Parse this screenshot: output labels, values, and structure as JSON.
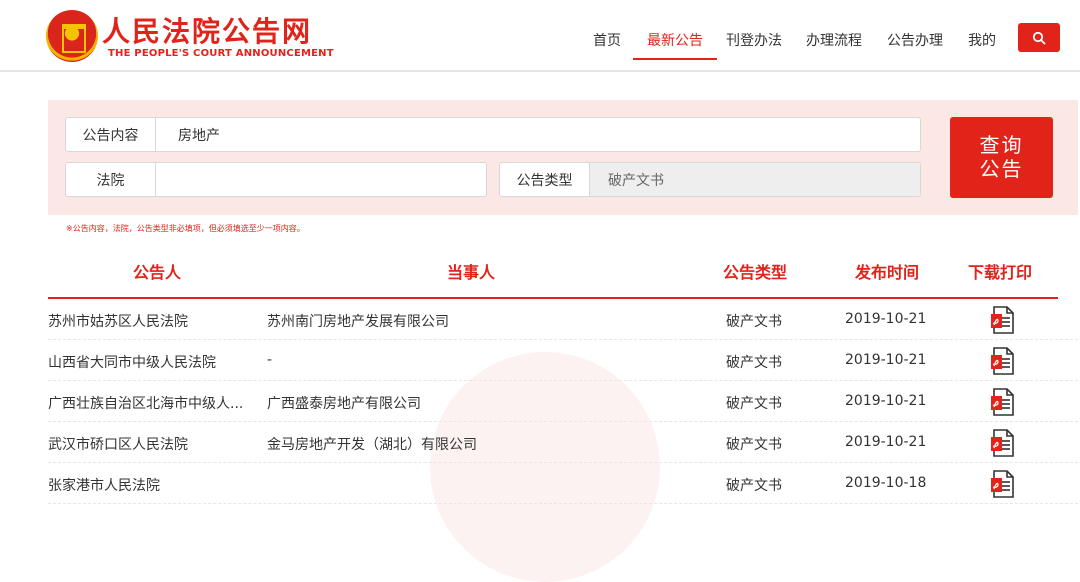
{
  "header": {
    "site_title": "人民法院公告网",
    "site_subtitle": "THE PEOPLE'S COURT ANNOUNCEMENT",
    "nav": [
      {
        "label": "首页"
      },
      {
        "label": "最新公告"
      },
      {
        "label": "刊登办法"
      },
      {
        "label": "办理流程"
      },
      {
        "label": "公告办理"
      },
      {
        "label": "我的"
      }
    ],
    "active_nav": "最新公告"
  },
  "search": {
    "content_label": "公告内容",
    "content_value": "房地产",
    "court_label": "法院",
    "court_value": "",
    "type_label": "公告类型",
    "type_value": "破产文书",
    "query_button_line1": "查询",
    "query_button_line2": "公告",
    "hint": "※公告内容，法院，公告类型非必填项，但必须填选至少一项内容。"
  },
  "table": {
    "headers": [
      "公告人",
      "当事人",
      "公告类型",
      "发布时间",
      "下载打印"
    ],
    "rows": [
      {
        "announcer": "苏州市姑苏区人民法院",
        "party": "苏州南门房地产发展有限公司",
        "type": "破产文书",
        "date": "2019-10-21"
      },
      {
        "announcer": "山西省大同市中级人民法院",
        "party": "-",
        "type": "破产文书",
        "date": "2019-10-21"
      },
      {
        "announcer": "广西壮族自治区北海市中级人...",
        "party": "广西盛泰房地产有限公司",
        "type": "破产文书",
        "date": "2019-10-21"
      },
      {
        "announcer": "武汉市硚口区人民法院",
        "party": "金马房地产开发（湖北）有限公司",
        "type": "破产文书",
        "date": "2019-10-21"
      },
      {
        "announcer": "张家港市人民法院",
        "party": "",
        "type": "破产文书",
        "date": "2019-10-18"
      }
    ]
  },
  "colors": {
    "brand": "#e2231a",
    "panel": "#fbe7e3"
  },
  "icons": {
    "search": "search-icon",
    "download": "pdf-icon"
  }
}
